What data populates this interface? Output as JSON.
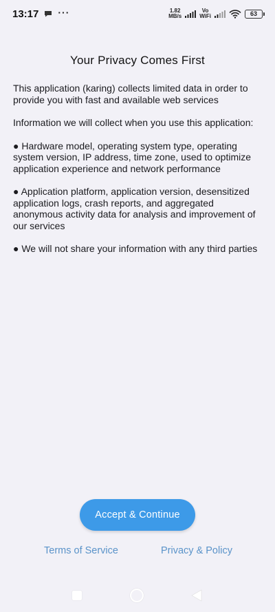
{
  "status_bar": {
    "time": "13:17",
    "dots": "···",
    "speed_value": "1.82",
    "speed_unit": "MB/s",
    "vowifi_top": "Vo",
    "vowifi_bottom": "WiFi",
    "battery": "63"
  },
  "page": {
    "title": "Your Privacy Comes First",
    "intro": "This application (karing) collects limited data in order to provide you with fast and available web services",
    "collect_heading": "Information we will collect when you use this application:",
    "bullet_1": "● Hardware model, operating system type, operating system version, IP address, time zone, used to optimize application experience and network performance",
    "bullet_2": "● Application platform, application version, desensitized application logs, crash reports, and aggregated anonymous activity data for analysis and improvement of our services",
    "bullet_3": "● We will not share your information with any third parties"
  },
  "actions": {
    "accept_label": "Accept & Continue",
    "terms_label": "Terms of Service",
    "privacy_label": "Privacy & Policy"
  },
  "colors": {
    "accent": "#3d9ae8",
    "link": "#5a93c9",
    "background": "#f2f1f7"
  }
}
